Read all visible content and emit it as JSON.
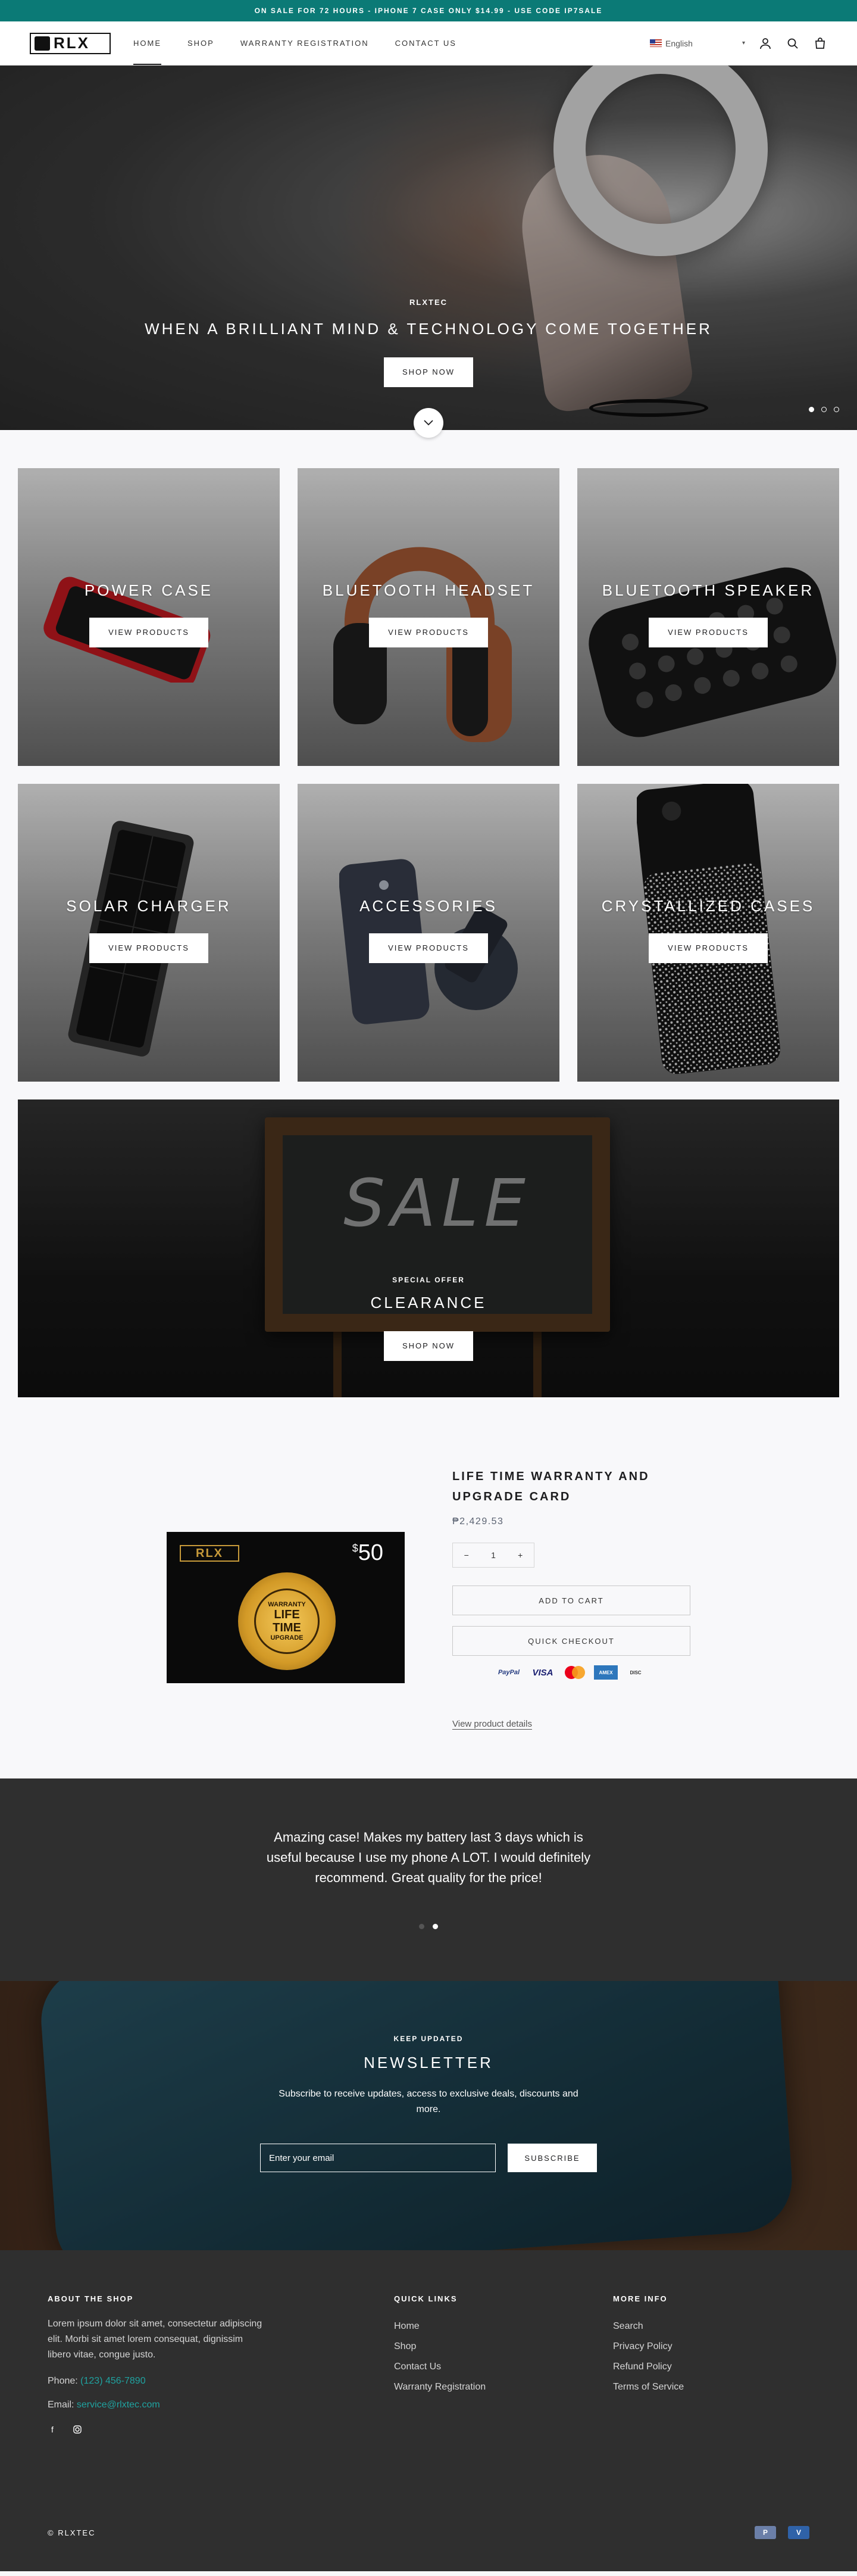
{
  "announcement": "ON SALE FOR 72 HOURS - IPHONE 7 CASE ONLY $14.99 - USE CODE IP7SALE",
  "header": {
    "logo_text": "RLX",
    "nav": [
      "HOME",
      "SHOP",
      "WARRANTY REGISTRATION",
      "CONTACT US"
    ],
    "active_nav": "HOME",
    "language": "English",
    "icons": [
      "account-icon",
      "search-icon",
      "cart-icon"
    ]
  },
  "hero": {
    "eyebrow": "RLXTEC",
    "title": "WHEN A BRILLIANT MIND & TECHNOLOGY COME TOGETHER",
    "button": "SHOP NOW",
    "slides_total": 3,
    "active_slide": 1
  },
  "collections": [
    {
      "title": "POWER CASE",
      "button": "VIEW PRODUCTS"
    },
    {
      "title": "BLUETOOTH HEADSET",
      "button": "VIEW PRODUCTS"
    },
    {
      "title": "BLUETOOTH SPEAKER",
      "button": "VIEW PRODUCTS"
    },
    {
      "title": "SOLAR CHARGER",
      "button": "VIEW PRODUCTS"
    },
    {
      "title": "ACCESSORIES",
      "button": "VIEW PRODUCTS"
    },
    {
      "title": "CRYSTALLIZED CASES",
      "button": "VIEW PRODUCTS"
    }
  ],
  "sale": {
    "chalk_text": "SALE",
    "eyebrow": "SPECIAL OFFER",
    "title": "CLEARANCE",
    "button": "SHOP NOW"
  },
  "product": {
    "title": "LIFE TIME WARRANTY AND UPGRADE CARD",
    "price": "₱2,429.53",
    "quantity": "1",
    "add_to_cart": "ADD TO CART",
    "quick_checkout": "QUICK CHECKOUT",
    "payment_methods": [
      "PayPal",
      "VISA",
      "Mastercard",
      "Amex",
      "Discover"
    ],
    "details_link": "View product details",
    "card": {
      "logo": "RLX",
      "price_symbol": "$",
      "price_value": "50",
      "seal_lines": [
        "WARRANTY",
        "LIFE",
        "TIME",
        "UPGRADE"
      ]
    }
  },
  "testimonial": {
    "quote": "Amazing case! Makes my battery last 3 days which is useful because I use my phone A LOT. I would definitely recommend. Great quality for the price!",
    "total": 2,
    "active": 2
  },
  "newsletter": {
    "eyebrow": "KEEP UPDATED",
    "title": "NEWSLETTER",
    "text": "Subscribe to receive updates, access to exclusive deals, discounts and more.",
    "placeholder": "Enter your email",
    "button": "SUBSCRIBE"
  },
  "footer": {
    "about_heading": "ABOUT THE SHOP",
    "about_text": "Lorem ipsum dolor sit amet, consectetur adipiscing elit. Morbi sit amet lorem consequat, dignissim libero vitae, congue justo.",
    "phone_label": "Phone:",
    "phone": "(123) 456-7890",
    "email_label": "Email:",
    "email": "service@rlxtec.com",
    "quick_links_heading": "QUICK LINKS",
    "quick_links": [
      "Home",
      "Shop",
      "Contact Us",
      "Warranty Registration"
    ],
    "more_info_heading": "MORE INFO",
    "more_info": [
      "Search",
      "Privacy Policy",
      "Refund Policy",
      "Terms of Service"
    ],
    "copyright": "© RLXTEC",
    "payment_icons": [
      "PayPal",
      "Venmo"
    ]
  }
}
